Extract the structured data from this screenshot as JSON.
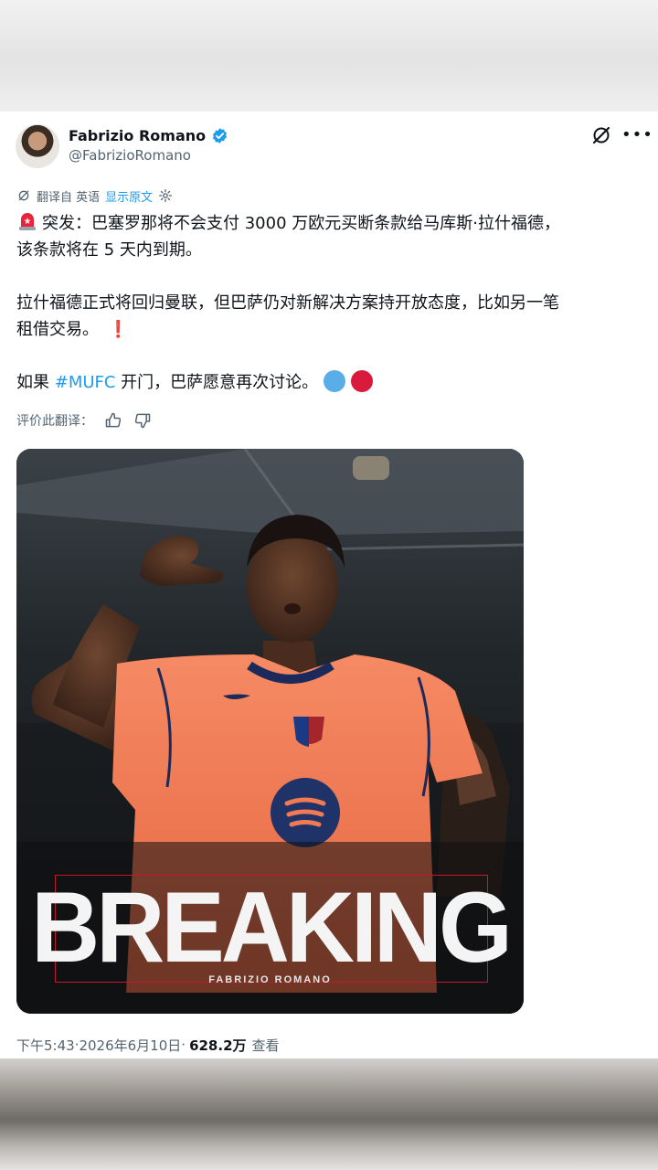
{
  "author": {
    "name": "Fabrizio Romano",
    "handle": "@FabrizioRomano"
  },
  "translation": {
    "translated_from": "翻译自 英语",
    "show_original": "显示原文"
  },
  "tweet": {
    "line1": "突发：巴塞罗那将不会支付 3000 万欧元买断条款给马库斯·拉什福德，",
    "line2": "该条款将在 5 天内到期。",
    "line3": "拉什福德正式将回归曼联，但巴萨仍对新解决方案持开放态度，比如另一笔",
    "line4": "租借交易。",
    "line5_prefix": "如果 ",
    "hashtag": "#MUFC",
    "line5_suffix": " 开门，巴萨愿意再次讨论。"
  },
  "rate": {
    "label": "评价此翻译："
  },
  "media": {
    "headline": "BREAKING",
    "byline": "FABRIZIO ROMANO"
  },
  "meta": {
    "time": "下午5:43",
    "sep": " · ",
    "date": "2026年6月10日",
    "views": "628.2万",
    "views_label": "查看"
  },
  "colors": {
    "accent": "#1d9bf0",
    "secondary_text": "#536471",
    "jersey": "#f07a54",
    "frame": "#c0192b"
  }
}
